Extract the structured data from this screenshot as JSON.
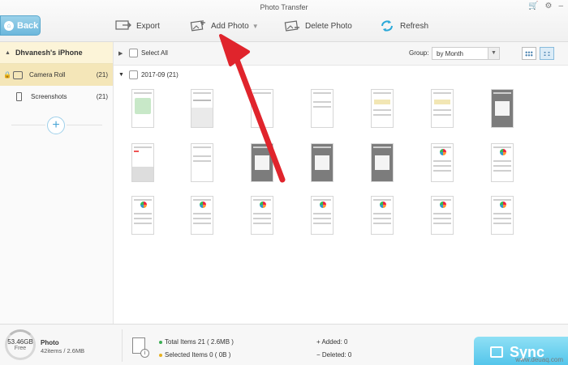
{
  "window": {
    "title": "Photo Transfer"
  },
  "toolbar": {
    "back_label": "Back",
    "export_label": "Export",
    "add_photo_label": "Add Photo",
    "delete_photo_label": "Delete Photo",
    "refresh_label": "Refresh"
  },
  "sidebar": {
    "device_name": "Dhvanesh's iPhone",
    "albums": [
      {
        "label": "Camera Roll",
        "count": "(21)",
        "icon": "camera-icon",
        "selected": true
      },
      {
        "label": "Screenshots",
        "count": "(21)",
        "icon": "phone-icon",
        "selected": false
      }
    ]
  },
  "filter": {
    "select_all_label": "Select All",
    "group_label": "Group:",
    "group_value": "by Month"
  },
  "content": {
    "date_group_label": "2017-09 (21)",
    "photo_count": 21
  },
  "status": {
    "storage_size": "53.46GB",
    "storage_free_label": "Free",
    "category_title": "Photo",
    "category_items": "42items / 2.6MB",
    "total_items": "Total Items 21 ( 2.6MB )",
    "selected_items": "Selected Items 0 ( 0B )",
    "added": "Added: 0",
    "deleted": "Deleted: 0",
    "sync_label": "Sync"
  },
  "watermark": "www.deuaq.com",
  "colors": {
    "accent_blue": "#4fc3ea",
    "selected_album": "#f4e6b8",
    "arrow_red": "#e0242c",
    "total_dot": "#3cae54",
    "selected_dot": "#e6b020"
  }
}
